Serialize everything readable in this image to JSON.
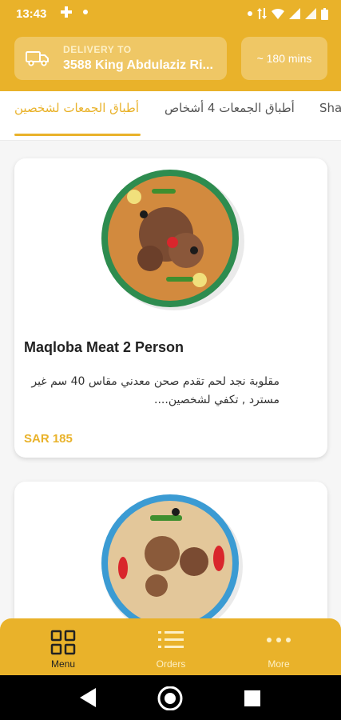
{
  "status_bar": {
    "time": "13:43"
  },
  "header": {
    "delivery_label": "DELIVERY TO",
    "delivery_address": "3588 King Abdulaziz Ri...",
    "eta": "~ 180 mins"
  },
  "tabs": [
    {
      "label": "أطباق الجمعات لشخصين",
      "active": true
    },
    {
      "label": "أطباق الجمعات 4 أشخاص",
      "active": false
    },
    {
      "label": "Sha",
      "active": false
    }
  ],
  "products": [
    {
      "title": "Maqloba Meat 2 Person",
      "description": "مقلوبة نجد لحم تقدم صحن معدني مقاس 40 سم غير مسترد , تكفي لشخصين....",
      "price": "SAR 185"
    },
    {
      "title": "",
      "description": "",
      "price": ""
    }
  ],
  "bottom_nav": {
    "menu": "Menu",
    "orders": "Orders",
    "more": "More"
  },
  "colors": {
    "accent": "#e9b22a",
    "background": "#f6f6f6",
    "card": "#ffffff"
  }
}
